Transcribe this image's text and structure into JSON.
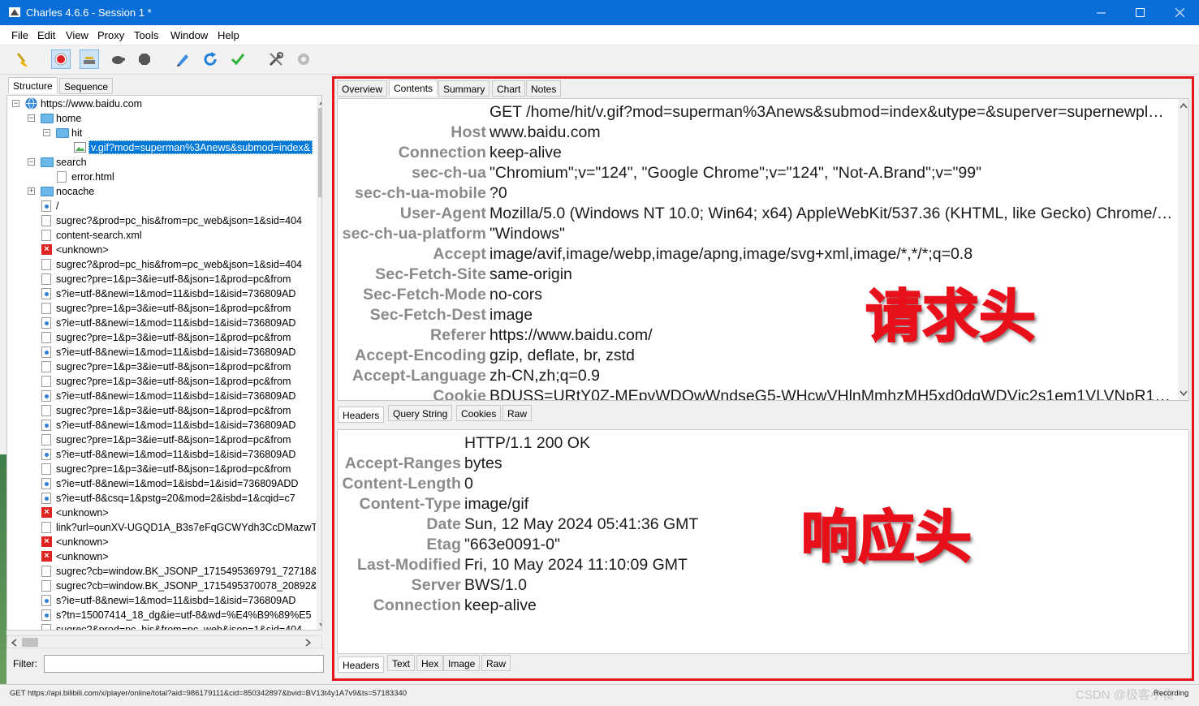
{
  "window": {
    "title": "Charles 4.6.6 - Session 1 *"
  },
  "menu": [
    "File",
    "Edit",
    "View",
    "Proxy",
    "Tools",
    "Window",
    "Help"
  ],
  "toolbar": [
    "broom-icon",
    "record-icon",
    "throttle-icon",
    "turtle-icon",
    "stop-hexagon-icon",
    "pen-icon",
    "refresh-icon",
    "check-icon",
    "tools-icon",
    "settings-icon"
  ],
  "left_tabs": [
    "Structure",
    "Sequence"
  ],
  "tree": {
    "host": "https://www.baidu.com",
    "home": "home",
    "hit": "hit",
    "selected": "v.gif?mod=superman%3Anews&submod=index&",
    "search": "search",
    "error": "error.html",
    "nocache": "nocache",
    "items": [
      {
        "icon": "doc-b",
        "text": "/"
      },
      {
        "icon": "doc",
        "text": "sugrec?&prod=pc_his&from=pc_web&json=1&sid=404"
      },
      {
        "icon": "doc",
        "text": "content-search.xml"
      },
      {
        "icon": "err",
        "text": "<unknown>"
      },
      {
        "icon": "doc",
        "text": "sugrec?&prod=pc_his&from=pc_web&json=1&sid=404"
      },
      {
        "icon": "doc",
        "text": "sugrec?pre=1&p=3&ie=utf-8&json=1&prod=pc&from"
      },
      {
        "icon": "doc-b",
        "text": "s?ie=utf-8&newi=1&mod=11&isbd=1&isid=736809AD"
      },
      {
        "icon": "doc",
        "text": "sugrec?pre=1&p=3&ie=utf-8&json=1&prod=pc&from"
      },
      {
        "icon": "doc-b",
        "text": "s?ie=utf-8&newi=1&mod=11&isbd=1&isid=736809AD"
      },
      {
        "icon": "doc",
        "text": "sugrec?pre=1&p=3&ie=utf-8&json=1&prod=pc&from"
      },
      {
        "icon": "doc-b",
        "text": "s?ie=utf-8&newi=1&mod=11&isbd=1&isid=736809AD"
      },
      {
        "icon": "doc",
        "text": "sugrec?pre=1&p=3&ie=utf-8&json=1&prod=pc&from"
      },
      {
        "icon": "doc",
        "text": "sugrec?pre=1&p=3&ie=utf-8&json=1&prod=pc&from"
      },
      {
        "icon": "doc-b",
        "text": "s?ie=utf-8&newi=1&mod=11&isbd=1&isid=736809AD"
      },
      {
        "icon": "doc",
        "text": "sugrec?pre=1&p=3&ie=utf-8&json=1&prod=pc&from"
      },
      {
        "icon": "doc-b",
        "text": "s?ie=utf-8&newi=1&mod=11&isbd=1&isid=736809AD"
      },
      {
        "icon": "doc",
        "text": "sugrec?pre=1&p=3&ie=utf-8&json=1&prod=pc&from"
      },
      {
        "icon": "doc-b",
        "text": "s?ie=utf-8&newi=1&mod=11&isbd=1&isid=736809AD"
      },
      {
        "icon": "doc",
        "text": "sugrec?pre=1&p=3&ie=utf-8&json=1&prod=pc&from"
      },
      {
        "icon": "doc-b",
        "text": "s?ie=utf-8&newi=1&mod=1&isbd=1&isid=736809ADD"
      },
      {
        "icon": "doc-b",
        "text": "s?ie=utf-8&csq=1&pstg=20&mod=2&isbd=1&cqid=c7"
      },
      {
        "icon": "err",
        "text": "<unknown>"
      },
      {
        "icon": "doc",
        "text": "link?url=ounXV-UGQD1A_B3s7eFqGCWYdh3CcDMazwT"
      },
      {
        "icon": "err",
        "text": "<unknown>"
      },
      {
        "icon": "err",
        "text": "<unknown>"
      },
      {
        "icon": "doc",
        "text": "sugrec?cb=window.BK_JSONP_1715495369791_72718&"
      },
      {
        "icon": "doc",
        "text": "sugrec?cb=window.BK_JSONP_1715495370078_20892&"
      },
      {
        "icon": "doc-b",
        "text": "s?ie=utf-8&newi=1&mod=11&isbd=1&isid=736809AD"
      },
      {
        "icon": "doc-b",
        "text": "s?tn=15007414_18_dg&ie=utf-8&wd=%E4%B9%89%E5"
      },
      {
        "icon": "doc",
        "text": "sugrec?&prod=pc_his&from=pc_web&json=1&sid=404"
      }
    ]
  },
  "filter": {
    "label": "Filter:",
    "value": ""
  },
  "right_tabs": [
    "Overview",
    "Contents",
    "Summary",
    "Chart",
    "Notes"
  ],
  "request": {
    "first_line": "GET /home/hit/v.gif?mod=superman%3Anews&submod=index&utype=&superver=supernewpl…",
    "headers": [
      {
        "k": "Host",
        "v": "www.baidu.com"
      },
      {
        "k": "Connection",
        "v": "keep-alive"
      },
      {
        "k": "sec-ch-ua",
        "v": "\"Chromium\";v=\"124\", \"Google Chrome\";v=\"124\", \"Not-A.Brand\";v=\"99\""
      },
      {
        "k": "sec-ch-ua-mobile",
        "v": "?0"
      },
      {
        "k": "User-Agent",
        "v": "Mozilla/5.0 (Windows NT 10.0; Win64; x64) AppleWebKit/537.36 (KHTML, like Gecko) Chrome/12…"
      },
      {
        "k": "sec-ch-ua-platform",
        "v": "\"Windows\""
      },
      {
        "k": "Accept",
        "v": "image/avif,image/webp,image/apng,image/svg+xml,image/*,*/*;q=0.8"
      },
      {
        "k": "Sec-Fetch-Site",
        "v": "same-origin"
      },
      {
        "k": "Sec-Fetch-Mode",
        "v": "no-cors"
      },
      {
        "k": "Sec-Fetch-Dest",
        "v": "image"
      },
      {
        "k": "Referer",
        "v": "https://www.baidu.com/"
      },
      {
        "k": "Accept-Encoding",
        "v": "gzip, deflate, br, zstd"
      },
      {
        "k": "Accept-Language",
        "v": "zh-CN,zh;q=0.9"
      },
      {
        "k": "Cookie",
        "v": "BDUSS=URtY0Z-MEpvWDQwWndseG5-WHcwVHlnMmhzMH5xd0dqWDVjc2s1em1VLVNpR1ZtS…"
      }
    ],
    "tabs": [
      "Headers",
      "Query String",
      "Cookies",
      "Raw"
    ],
    "overlay": "请求头"
  },
  "response": {
    "first_line": "HTTP/1.1 200 OK",
    "headers": [
      {
        "k": "Accept-Ranges",
        "v": "bytes"
      },
      {
        "k": "Content-Length",
        "v": "0"
      },
      {
        "k": "Content-Type",
        "v": "image/gif"
      },
      {
        "k": "Date",
        "v": "Sun, 12 May 2024 05:41:36 GMT"
      },
      {
        "k": "Etag",
        "v": "\"663e0091-0\""
      },
      {
        "k": "Last-Modified",
        "v": "Fri, 10 May 2024 11:10:09 GMT"
      },
      {
        "k": "Server",
        "v": "BWS/1.0"
      },
      {
        "k": "Connection",
        "v": "keep-alive"
      }
    ],
    "tabs": [
      "Headers",
      "Text",
      "Hex",
      "Image",
      "Raw"
    ],
    "overlay": "响应头"
  },
  "statusbar": {
    "text": "GET https://api.bilibili.com/x/player/online/total?aid=986179111&cid=850342897&bvid=BV13t4y1A7v9&ts=57183340",
    "recording": "Recording",
    "watermark": "CSDN @极客小俊"
  },
  "colors": {
    "titlebar": "#0a6ed8",
    "highlight_border": "#e5151b",
    "overlay_text": "#e8101a",
    "selection": "#0078d7"
  }
}
